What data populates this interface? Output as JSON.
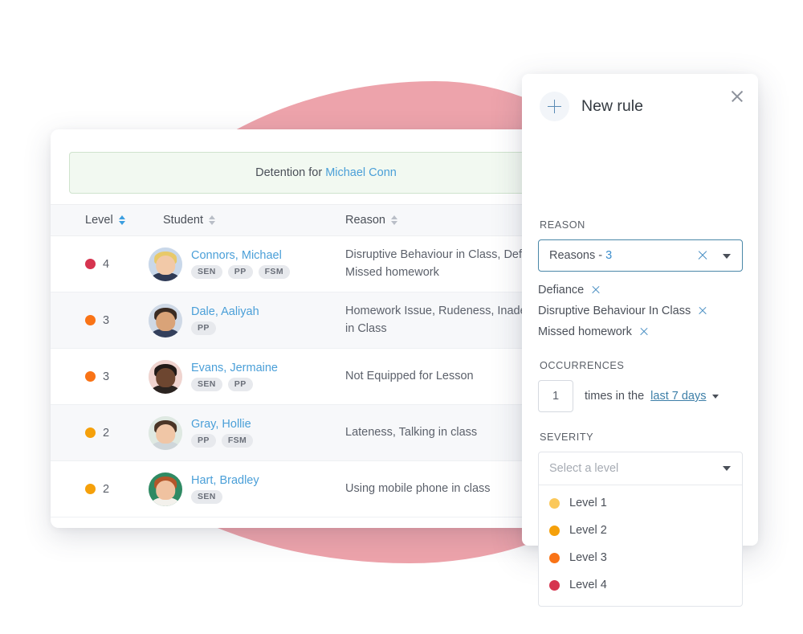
{
  "decor": {
    "blob_color": "#eda3ab"
  },
  "banner": {
    "prefix": "Detention for ",
    "student_link": "Michael Conn"
  },
  "table": {
    "headers": [
      {
        "label": "Level",
        "sort": "active"
      },
      {
        "label": "Student",
        "sort": "inactive"
      },
      {
        "label": "Reason",
        "sort": "inactive"
      }
    ],
    "rows": [
      {
        "level": "4",
        "level_color": "#d6344f",
        "name": "Connors, Michael",
        "tags": [
          "SEN",
          "PP",
          "FSM"
        ],
        "reason": "Disruptive Behaviour in Class, Defiance, Missed homework",
        "avatar": {
          "bg": "#c9d8ea",
          "hair": "#e8c969",
          "skin": "#f2c9a8",
          "body": "#2f3a55"
        }
      },
      {
        "level": "3",
        "level_color": "#f97316",
        "name": "Dale, Aaliyah",
        "tags": [
          "PP"
        ],
        "reason": "Homework Issue, Rudeness, Inadequate Work in Class",
        "avatar": {
          "bg": "#cfd9e6",
          "hair": "#3a2b22",
          "skin": "#d9a378",
          "body": "#34405c"
        }
      },
      {
        "level": "3",
        "level_color": "#f97316",
        "name": "Evans, Jermaine",
        "tags": [
          "SEN",
          "PP"
        ],
        "reason": "Not Equipped for Lesson",
        "avatar": {
          "bg": "#f0d4cf",
          "hair": "#211a17",
          "skin": "#6d4630",
          "body": "#2a2320"
        }
      },
      {
        "level": "2",
        "level_color": "#f5a00a",
        "name": "Gray, Hollie",
        "tags": [
          "PP",
          "FSM"
        ],
        "reason": "Lateness, Talking in class",
        "avatar": {
          "bg": "#dfe9e2",
          "hair": "#4a3526",
          "skin": "#f0c6a6",
          "body": "#cfd6da"
        }
      },
      {
        "level": "2",
        "level_color": "#f5a00a",
        "name": "Hart, Bradley",
        "tags": [
          "SEN"
        ],
        "reason": "Using mobile phone in class",
        "avatar": {
          "bg": "#2f8a63",
          "hair": "#b4562a",
          "skin": "#f0c2a0",
          "body": "#f3f1ec"
        }
      }
    ]
  },
  "panel": {
    "title": "New rule",
    "add_icon": "plus-icon",
    "close_icon": "close-icon",
    "reason": {
      "label": "REASON",
      "value_prefix": "Reasons - ",
      "value_count": "3",
      "chips": [
        {
          "label": "Defiance"
        },
        {
          "label": "Disruptive Behaviour In Class"
        },
        {
          "label": "Missed homework"
        }
      ]
    },
    "occurrences": {
      "label": "OCCURRENCES",
      "value": "1",
      "text": "times in the",
      "period": "last 7 days"
    },
    "severity": {
      "label": "SEVERITY",
      "placeholder": "Select a level",
      "options": [
        {
          "label": "Level 1",
          "color": "#fbc85a"
        },
        {
          "label": "Level 2",
          "color": "#f5a00a"
        },
        {
          "label": "Level 3",
          "color": "#f97316"
        },
        {
          "label": "Level 4",
          "color": "#d6344f"
        }
      ]
    }
  }
}
